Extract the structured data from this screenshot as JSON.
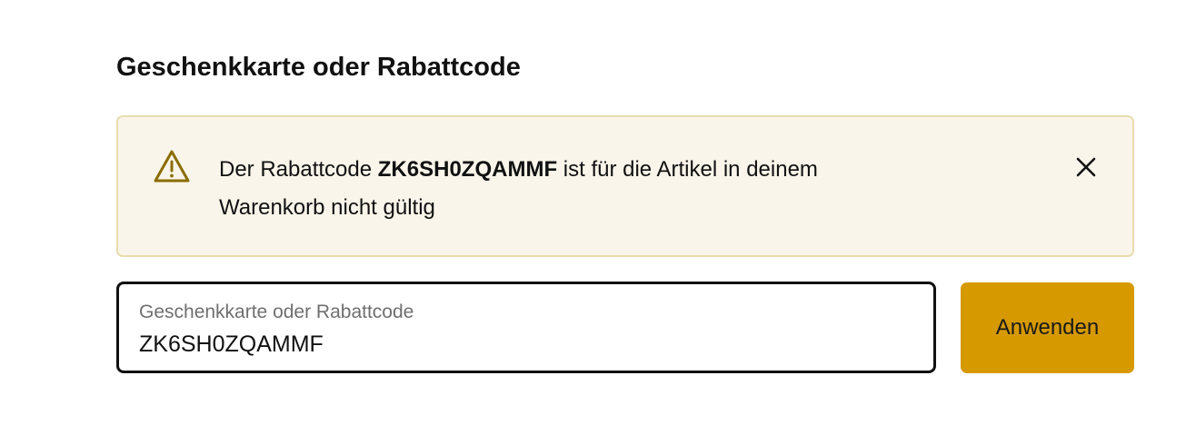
{
  "section": {
    "title": "Geschenkkarte oder Rabattcode"
  },
  "alert": {
    "icon": "warning-triangle-icon",
    "message_prefix": "Der Rabattcode",
    "code": "ZK6SH0ZQAMMF",
    "message_line1_suffix": "ist für die Artikel in deinem",
    "message_line2": "Warenkorb nicht gültig",
    "close_icon": "close-icon",
    "background_color": "#faf5ea",
    "border_color": "#e8dcae",
    "icon_color": "#8a6d00"
  },
  "code_field": {
    "label": "Geschenkkarte oder Rabattcode",
    "value": "ZK6SH0ZQAMMF"
  },
  "apply_button": {
    "label": "Anwenden",
    "color": "#d69a00"
  }
}
